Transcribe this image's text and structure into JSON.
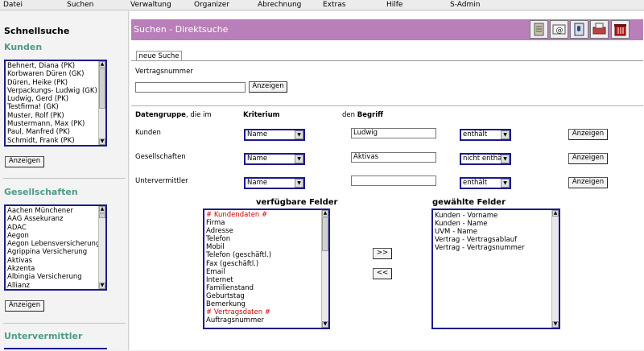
{
  "menu": [
    "Datei",
    "Suchen",
    "Verwaltung",
    "Organizer",
    "Abrechnung",
    "Extras",
    "Hilfe",
    "S-Admin"
  ],
  "sidebar": {
    "title": "Schnellsuche",
    "kunden": {
      "heading": "Kunden",
      "items": [
        "Behnert, Diana (PK)",
        "Korbwaren Düren (GK)",
        "Düren, Heike (PK)",
        "Verpackungs- Ludwig (GK)",
        "Ludwig, Gerd (PK)",
        "Testfirma! (GK)",
        "Muster, Rolf (PK)",
        "Mustermann, Max (PK)",
        "Paul, Manfred (PK)",
        "Schmidt, Frank (PK)"
      ],
      "button": "Anzeigen"
    },
    "gesellschaften": {
      "heading": "Gesellschaften",
      "items": [
        "Aachen Münchener",
        "AAG Assekuranz",
        "ADAC",
        "Aegon",
        "Aegon Lebensversicherungs",
        "Agrippina Versicherung",
        "Aktivas",
        "Akzenta",
        "Albingia Versicherung",
        "Allianz"
      ],
      "button": "Anzeigen"
    },
    "untervermittler": {
      "heading": "Untervermittler"
    }
  },
  "header": {
    "title": "Suchen - Direktsuche",
    "icons": [
      "document-icon",
      "email-icon",
      "phone-book-icon",
      "print-icon",
      "trash-icon"
    ]
  },
  "tab": "neue Suche",
  "vertrag": {
    "label": "Vertragsnummer",
    "value": "",
    "button": "Anzeigen"
  },
  "columns": {
    "datengruppe_bold": "Datengruppe",
    "datengruppe_rest": ", die im",
    "kriterium": "Kriterium",
    "den": "den",
    "begriff": "Begriff"
  },
  "rows": [
    {
      "label": "Kunden",
      "kriterium": "Name",
      "value": "Ludwig",
      "operator": "enthält",
      "button": "Anzeigen"
    },
    {
      "label": "Gesellschaften",
      "kriterium": "Name",
      "value": "Aktivas",
      "operator": "nicht enthält",
      "button": "Anzeigen"
    },
    {
      "label": "Untervermittler",
      "kriterium": "Name",
      "value": "",
      "operator": "enthält",
      "button": "Anzeigen"
    }
  ],
  "available": {
    "heading": "verfügbare Felder",
    "items": [
      {
        "text": "# Kundendaten #",
        "red": true
      },
      {
        "text": "Firma"
      },
      {
        "text": "Adresse"
      },
      {
        "text": "Telefon"
      },
      {
        "text": "Mobil"
      },
      {
        "text": "Telefon (geschäftl.)"
      },
      {
        "text": "Fax (geschäftl.)"
      },
      {
        "text": "Email"
      },
      {
        "text": "Internet"
      },
      {
        "text": "Familienstand"
      },
      {
        "text": "Geburtstag"
      },
      {
        "text": "Bemerkung"
      },
      {
        "text": "# Vertragsdaten #",
        "red": true
      },
      {
        "text": "Auftragsnummer"
      }
    ]
  },
  "selected": {
    "heading": "gewählte Felder",
    "items": [
      "Kunden - Vorname",
      "Kunden - Name",
      "UVM - Name",
      "Vertrag - Vertragsablauf",
      "Vertrag - Vertragsnummer"
    ]
  },
  "move": {
    "add": ">>",
    "remove": "<<"
  },
  "colors": {
    "header": "#b87fb8",
    "section": "#4d9b8a",
    "listborder": "#1a1a8c",
    "red": "#d00000"
  }
}
